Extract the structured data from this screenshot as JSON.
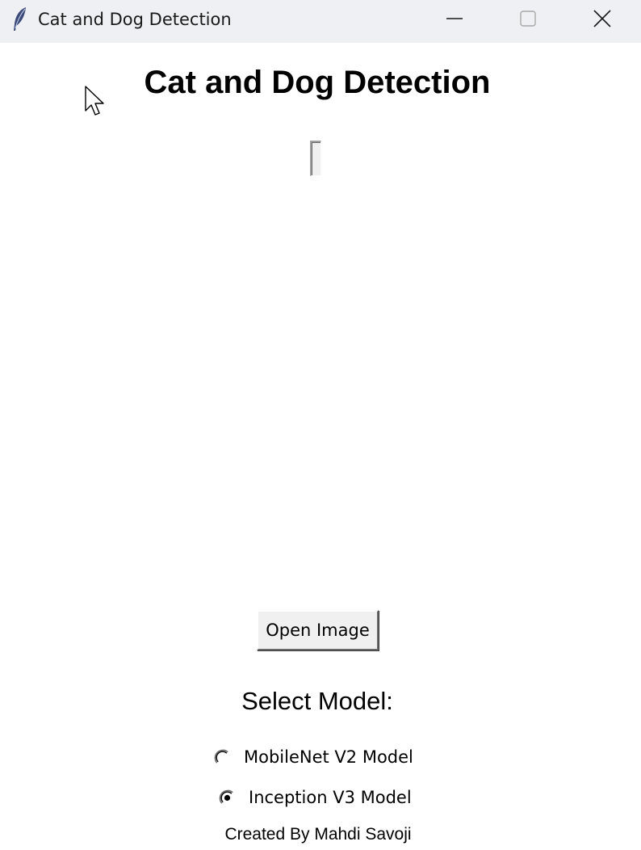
{
  "window": {
    "title": "Cat and Dog Detection",
    "controls": {
      "minimize": "minimize-icon",
      "maximize": "maximize-icon",
      "close": "close-icon"
    },
    "app_icon": "feather-icon"
  },
  "main": {
    "heading": "Cat and Dog Detection",
    "open_button_label": "Open Image",
    "select_label": "Select Model:",
    "models": [
      {
        "label": "MobileNet V2 Model",
        "selected": false
      },
      {
        "label": "Inception V3 Model",
        "selected": true
      }
    ],
    "footer": "Created By Mahdi Savoji"
  },
  "colors": {
    "titlebar_bg": "#eff0f4",
    "content_bg": "#ffffff",
    "button_face": "#f0f0f0"
  }
}
